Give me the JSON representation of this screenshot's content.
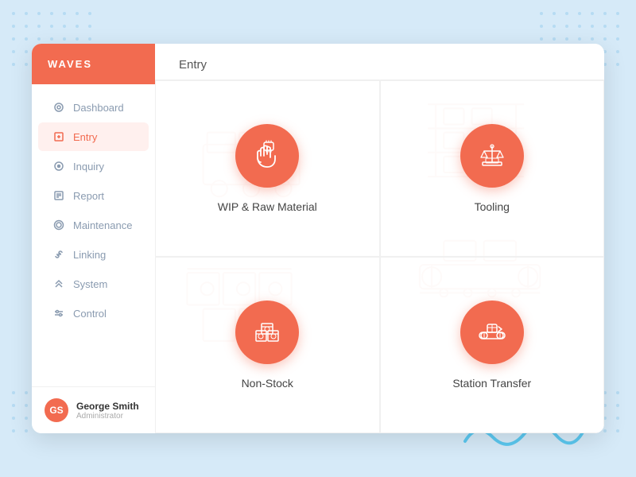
{
  "app": {
    "name": "WAVES"
  },
  "sidebar": {
    "nav_items": [
      {
        "id": "dashboard",
        "label": "Dashboard",
        "icon": "⊙",
        "active": false
      },
      {
        "id": "entry",
        "label": "Entry",
        "icon": "✎",
        "active": true
      },
      {
        "id": "inquiry",
        "label": "Inquiry",
        "icon": "◎",
        "active": false
      },
      {
        "id": "report",
        "label": "Report",
        "icon": "⊞",
        "active": false
      },
      {
        "id": "maintenance",
        "label": "Maintenance",
        "icon": "⊙",
        "active": false
      },
      {
        "id": "linking",
        "label": "Linking",
        "icon": "⌖",
        "active": false
      },
      {
        "id": "system",
        "label": "System",
        "icon": "⊲",
        "active": false
      },
      {
        "id": "control",
        "label": "Control",
        "icon": "≡",
        "active": false
      }
    ],
    "user": {
      "name": "George Smith",
      "role": "Administrator",
      "initials": "GS"
    }
  },
  "main": {
    "header": "Entry",
    "cards": [
      {
        "id": "wip",
        "label": "WIP & Raw Material"
      },
      {
        "id": "tooling",
        "label": "Tooling"
      },
      {
        "id": "non-stock",
        "label": "Non-Stock"
      },
      {
        "id": "station-transfer",
        "label": "Station Transfer"
      }
    ]
  }
}
